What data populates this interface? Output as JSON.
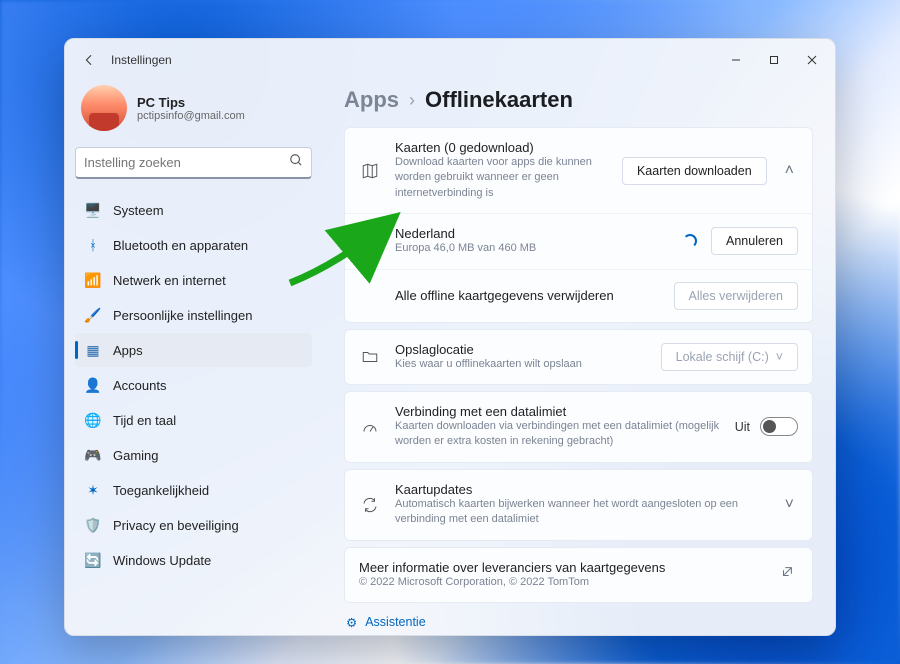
{
  "window": {
    "title": "Instellingen"
  },
  "profile": {
    "name": "PC Tips",
    "email": "pctipsinfo@gmail.com"
  },
  "search": {
    "placeholder": "Instelling zoeken"
  },
  "sidebar": {
    "items": [
      {
        "label": "Systeem"
      },
      {
        "label": "Bluetooth en apparaten"
      },
      {
        "label": "Netwerk en internet"
      },
      {
        "label": "Persoonlijke instellingen"
      },
      {
        "label": "Apps"
      },
      {
        "label": "Accounts"
      },
      {
        "label": "Tijd en taal"
      },
      {
        "label": "Gaming"
      },
      {
        "label": "Toegankelijkheid"
      },
      {
        "label": "Privacy en beveiliging"
      },
      {
        "label": "Windows Update"
      }
    ]
  },
  "breadcrumb": {
    "root": "Apps",
    "current": "Offlinekaarten"
  },
  "maps": {
    "title": "Kaarten (0 gedownload)",
    "sub": "Download kaarten voor apps die kunnen worden gebruikt wanneer er geen internetverbinding is",
    "download_label": "Kaarten downloaden",
    "item": {
      "title": "Nederland",
      "sub": "Europa  46,0 MB van 460 MB",
      "cancel": "Annuleren"
    },
    "delete_row": "Alle offline kaartgegevens verwijderen",
    "delete_btn": "Alles verwijderen"
  },
  "storage": {
    "title": "Opslaglocatie",
    "sub": "Kies waar u offlinekaarten wilt opslaan",
    "value": "Lokale schijf (C:)"
  },
  "metered": {
    "title": "Verbinding met een datalimiet",
    "sub": "Kaarten downloaden via verbindingen met een datalimiet (mogelijk worden er extra kosten in rekening gebracht)",
    "state": "Uit"
  },
  "updates": {
    "title": "Kaartupdates",
    "sub": "Automatisch kaarten bijwerken wanneer het wordt aangesloten op een verbinding met een datalimiet"
  },
  "info": {
    "title": "Meer informatie over leveranciers van kaartgegevens",
    "sub": "© 2022 Microsoft Corporation, © 2022 TomTom"
  },
  "assist": {
    "label": "Assistentie"
  }
}
